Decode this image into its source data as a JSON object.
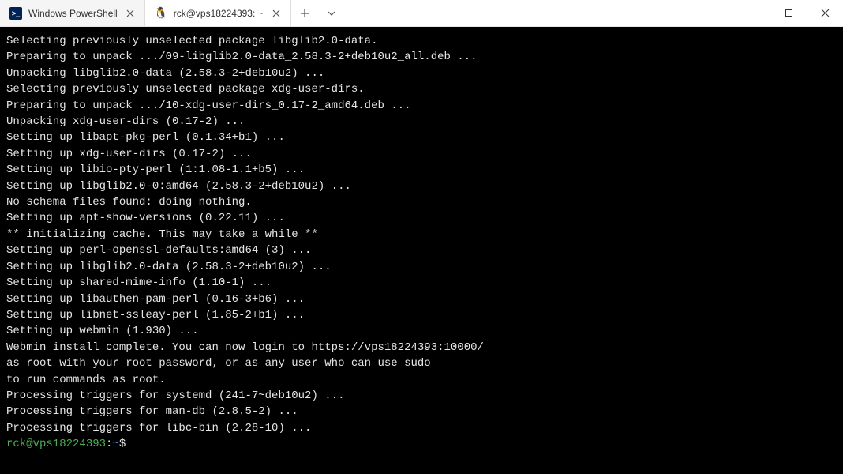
{
  "tabs": [
    {
      "label": "Windows PowerShell",
      "icon": "powershell-icon",
      "active": false
    },
    {
      "label": "rck@vps18224393: ~",
      "icon": "tux-icon",
      "active": true
    }
  ],
  "terminal_lines": [
    "Selecting previously unselected package libglib2.0-data.",
    "Preparing to unpack .../09-libglib2.0-data_2.58.3-2+deb10u2_all.deb ...",
    "Unpacking libglib2.0-data (2.58.3-2+deb10u2) ...",
    "Selecting previously unselected package xdg-user-dirs.",
    "Preparing to unpack .../10-xdg-user-dirs_0.17-2_amd64.deb ...",
    "Unpacking xdg-user-dirs (0.17-2) ...",
    "Setting up libapt-pkg-perl (0.1.34+b1) ...",
    "Setting up xdg-user-dirs (0.17-2) ...",
    "Setting up libio-pty-perl (1:1.08-1.1+b5) ...",
    "Setting up libglib2.0-0:amd64 (2.58.3-2+deb10u2) ...",
    "No schema files found: doing nothing.",
    "Setting up apt-show-versions (0.22.11) ...",
    "** initializing cache. This may take a while **",
    "Setting up perl-openssl-defaults:amd64 (3) ...",
    "Setting up libglib2.0-data (2.58.3-2+deb10u2) ...",
    "Setting up shared-mime-info (1.10-1) ...",
    "Setting up libauthen-pam-perl (0.16-3+b6) ...",
    "Setting up libnet-ssleay-perl (1.85-2+b1) ...",
    "Setting up webmin (1.930) ...",
    "Webmin install complete. You can now login to https://vps18224393:10000/",
    "as root with your root password, or as any user who can use sudo",
    "to run commands as root.",
    "Processing triggers for systemd (241-7~deb10u2) ...",
    "Processing triggers for man-db (2.8.5-2) ...",
    "Processing triggers for libc-bin (2.28-10) ..."
  ],
  "prompt": {
    "user_host": "rck@vps18224393",
    "colon": ":",
    "path": "~",
    "dollar": "$ "
  },
  "powershell_glyph": ">_",
  "tux_glyph": "🐧"
}
